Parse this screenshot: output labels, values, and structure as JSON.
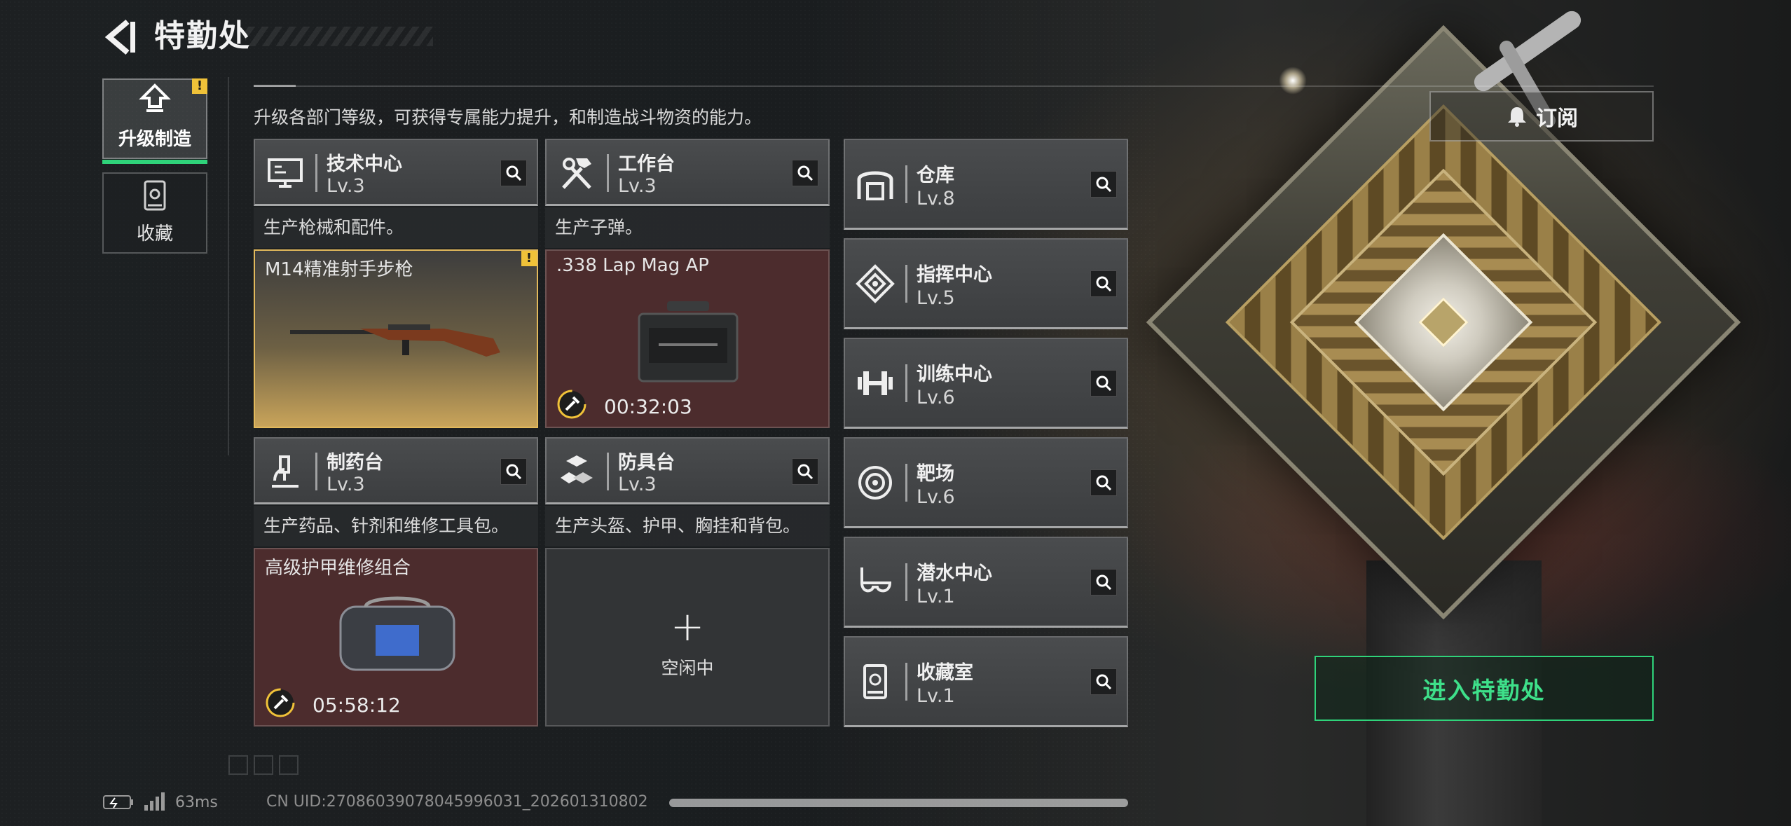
{
  "header": {
    "title": "特勤处"
  },
  "nav": {
    "tabs": [
      {
        "label": "升级制造",
        "active": true,
        "alert": "!"
      },
      {
        "label": "收藏",
        "active": false
      }
    ]
  },
  "subtitle": "升级各部门等级，可获得专属能力提升，和制造战斗物资的能力。",
  "subscribe_label": "订阅",
  "departments": [
    {
      "name": "技术中心",
      "level": "Lv.3",
      "description": "生产枪械和配件。",
      "item": {
        "name": "M14精准射手步枪",
        "state": "ready",
        "alert": "!"
      }
    },
    {
      "name": "工作台",
      "level": "Lv.3",
      "description": "生产子弹。",
      "item": {
        "name": ".338 Lap Mag AP",
        "state": "producing",
        "timer": "00:32:03"
      }
    },
    {
      "name": "制药台",
      "level": "Lv.3",
      "description": "生产药品、针剂和维修工具包。",
      "item": {
        "name": "高级护甲维修组合",
        "state": "producing",
        "timer": "05:58:12"
      }
    },
    {
      "name": "防具台",
      "level": "Lv.3",
      "description": "生产头盔、护甲、胸挂和背包。",
      "item": {
        "state": "idle",
        "plus": "+",
        "idle_label": "空闲中"
      }
    }
  ],
  "facilities": [
    {
      "name": "仓库",
      "level": "Lv.8",
      "icon": "warehouse-icon"
    },
    {
      "name": "指挥中心",
      "level": "Lv.5",
      "icon": "command-center-icon"
    },
    {
      "name": "训练中心",
      "level": "Lv.6",
      "icon": "dumbbell-icon"
    },
    {
      "name": "靶场",
      "level": "Lv.6",
      "icon": "target-icon"
    },
    {
      "name": "潜水中心",
      "level": "Lv.1",
      "icon": "diving-mask-icon"
    },
    {
      "name": "收藏室",
      "level": "Lv.1",
      "icon": "collection-icon"
    }
  ],
  "enter_button": "进入特勤处",
  "status": {
    "ping": "63ms",
    "uid": "CN UID:270860390780459960​31_202601310802"
  },
  "colors": {
    "accent_green": "#2fd37a",
    "alert_yellow": "#f0c239",
    "producing_red": "#4c2c2d",
    "ready_gold": "#c9a45a"
  }
}
